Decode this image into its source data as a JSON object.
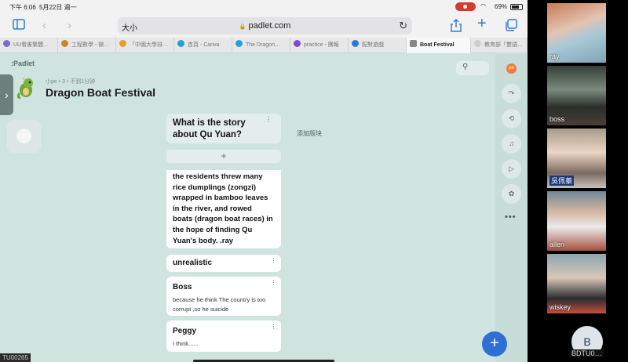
{
  "status": {
    "time": "下午 6:06",
    "date": "5月22日 週一",
    "battery": "69%"
  },
  "browser": {
    "text_size": "大小",
    "url": "padlet.com",
    "tabs": [
      {
        "label": "UU看書繁體…",
        "color": "#7c6bd6"
      },
      {
        "label": "工程數學 - 微…",
        "color": "#c9872c"
      },
      {
        "label": "「中國大學排…",
        "color": "#e2a12b"
      },
      {
        "label": "首頁 - Canva",
        "color": "#2a9fd6"
      },
      {
        "label": "The Dragon…",
        "color": "#2a9fd6"
      },
      {
        "label": "practice - 團報",
        "color": "#7b4fc9"
      },
      {
        "label": "配對遊戲",
        "color": "#2a7ad8"
      },
      {
        "label": "Boat Festival",
        "color": "#888888"
      },
      {
        "label": "教育部「雙語…",
        "color": "#cccccc"
      }
    ]
  },
  "padlet": {
    "logo": ":Padlet",
    "meta": "小pe • 3 • 不到1分钟",
    "board_title": "Dragon Boat Festival",
    "avatar_initials": "pe",
    "section_title": "What is the story about Qu Yuan?",
    "add_section": "添加版块",
    "add_post": "+",
    "posts": [
      {
        "title": "",
        "body": "the residents threw many rice dumplings (zongzi) wrapped in bamboo leaves in the river, and rowed boats (dragon boat races) in the hope of finding Qu Yuan's body. .ray"
      },
      {
        "title": "unrealistic",
        "body": ""
      },
      {
        "title": "Boss",
        "body": "because he think The country is too corrupt ,so he suicide"
      },
      {
        "title": "Peggy",
        "body": "I think......"
      }
    ],
    "fab": "+"
  },
  "participants": [
    {
      "name": "ray"
    },
    {
      "name": "boss"
    },
    {
      "name": "吳佩蓁"
    },
    {
      "name": "allen"
    },
    {
      "name": "wiskey"
    }
  ],
  "bottom": {
    "left_label": "TU00265",
    "avatar_letter": "B",
    "avatar_name": "BDTU0…"
  }
}
